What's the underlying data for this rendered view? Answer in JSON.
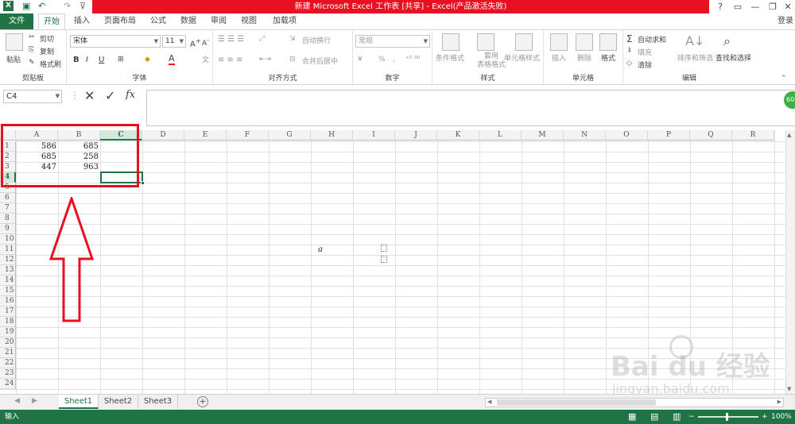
{
  "title_bar": {
    "title": "新建 Microsoft Excel 工作表 [共享] - Excel(产品激活失败)",
    "help": "?",
    "window_buttons": [
      "ribbon-display-icon",
      "minimize-icon",
      "restore-icon",
      "close-icon"
    ]
  },
  "tabs": [
    {
      "label": "文件"
    },
    {
      "label": "开始"
    },
    {
      "label": "插入"
    },
    {
      "label": "页面布局"
    },
    {
      "label": "公式"
    },
    {
      "label": "数据"
    },
    {
      "label": "审阅"
    },
    {
      "label": "视图"
    },
    {
      "label": "加载项"
    }
  ],
  "login": "登录",
  "ribbon": {
    "clipboard": {
      "label": "剪贴板",
      "paste": "粘贴",
      "cut": "剪切",
      "copy": "复制",
      "format_painter": "格式刷"
    },
    "font": {
      "label": "字体",
      "font_name": "宋体",
      "font_size": "11",
      "bold": "B",
      "italic": "I",
      "underline": "U"
    },
    "alignment": {
      "label": "对齐方式",
      "wrap": "自动换行",
      "merge": "合并后居中"
    },
    "number": {
      "label": "数字",
      "format": "常规",
      "percent": "%"
    },
    "styles": {
      "label": "样式",
      "cond_fmt": "条件格式",
      "table_fmt": "套用\n表格格式",
      "cell_style": "单元格样式"
    },
    "cells": {
      "label": "单元格",
      "insert": "插入",
      "delete": "删除",
      "format": "格式"
    },
    "editing": {
      "label": "编辑",
      "autosum": "自动求和",
      "fill": "填充",
      "clear": "清除",
      "sort": "排序和筛选",
      "find": "查找和选择"
    }
  },
  "formula_bar": {
    "name_box": "C4",
    "fx": "fx",
    "value": ""
  },
  "columns": [
    "A",
    "B",
    "C",
    "D",
    "E",
    "F",
    "G",
    "H",
    "I",
    "J",
    "K",
    "L",
    "M",
    "N",
    "O",
    "P",
    "Q",
    "R"
  ],
  "rows": [
    "1",
    "2",
    "3",
    "4",
    "5",
    "6",
    "7",
    "8",
    "9",
    "10",
    "11",
    "12",
    "13",
    "14",
    "15",
    "16",
    "17",
    "18",
    "19",
    "20",
    "21",
    "22",
    "23",
    "24"
  ],
  "cells": {
    "A1": "586",
    "B1": "685",
    "A2": "685",
    "B2": "258",
    "A3": "447",
    "B3": "963",
    "H11": "a"
  },
  "sheet_tabs": {
    "tabs": [
      "Sheet1",
      "Sheet2",
      "Sheet3"
    ],
    "active": "Sheet1",
    "add": "+"
  },
  "status": {
    "mode": "输入",
    "zoom": "100%"
  },
  "watermark": {
    "logo": "Bai du 经验",
    "url": "jingyan.baidu.com"
  },
  "colors": {
    "excel_green": "#217346",
    "title_red": "#e81123",
    "annotation_red": "#e8101f"
  }
}
